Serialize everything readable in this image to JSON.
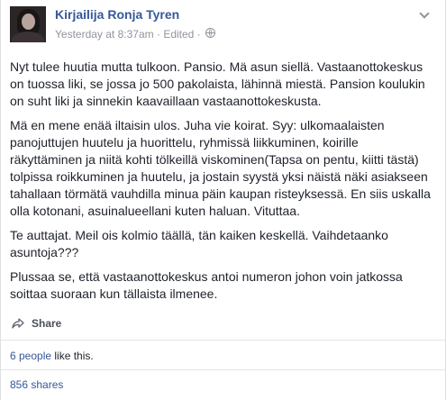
{
  "post": {
    "author": "Kirjailija Ronja Tyren",
    "timestamp": "Yesterday at 8:37am",
    "separator": " · ",
    "edited": "Edited",
    "privacy_icon": "globe-icon",
    "paragraphs": [
      "Nyt tulee huutia mutta tulkoon. Pansio. Mä asun siellä. Vastaanottokeskus\non tuossa liki, se jossa jo 500 pakolaista, lähinnä miestä. Pansion koulukin\non suht liki ja sinnekin kaavaillaan vastaanottokeskusta.",
      "Mä en mene enää iltaisin ulos. Juha vie koirat. Syy: ulkomaalaisten\npanojuttujen huutelu ja huorittelu, ryhmissä liikkuminen, koirille\nräkyttäminen ja niitä kohti tölkeillä viskominen(Tapsa on pentu, kiitti tästä)\ntolpissa roikkuminen ja huutelu, ja jostain syystä yksi näistä näki asiakseen\ntahallaan törmätä vauhdilla minua päin kaupan risteyksessä. En siis uskalla\nolla kotonani, asuinalueellani kuten haluan. Vituttaa.",
      "Te auttajat. Meil ois kolmio täällä, tän kaiken keskellä. Vaihdetaanko\nasuntoja???",
      "Plussaa se, että vastaanottokeskus antoi numeron johon voin jatkossa\nsoittaa suoraan kun tällaista ilmenee."
    ]
  },
  "actions": {
    "share_label": "Share"
  },
  "stats": {
    "likes_link": "6 people",
    "likes_suffix": " like this.",
    "shares": "856 shares"
  },
  "colors": {
    "link": "#365899",
    "meta": "#90949c",
    "text": "#1d2129"
  }
}
